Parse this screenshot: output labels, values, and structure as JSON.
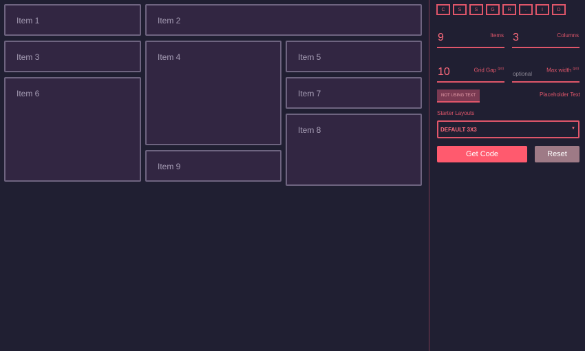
{
  "grid": {
    "items": [
      "Item 1",
      "Item 2",
      "Item 3",
      "Item 4",
      "Item 5",
      "Item 6",
      "Item 7",
      "Item 8",
      "Item 9"
    ]
  },
  "sidebar": {
    "logo_letters": [
      "C",
      "S",
      "S",
      "G",
      "R",
      ".",
      "I",
      "D"
    ],
    "items_field": {
      "value": "9",
      "label": "Items"
    },
    "columns_field": {
      "value": "3",
      "label": "Columns"
    },
    "gap_field": {
      "value": "10",
      "label": "Grid Gap",
      "unit": "(px)"
    },
    "max_width_field": {
      "placeholder": "optional",
      "label": "Max width",
      "unit": "(px)"
    },
    "text_toggle": "NOT USING TEXT",
    "placeholder_text_label": "Placeholder Text",
    "starter_label": "Starter Layouts",
    "starter_selected": "DEFAULT 3X3",
    "get_code": "Get Code",
    "reset": "Reset"
  },
  "colors": {
    "accent": "#ff5a6e",
    "background": "#201f32",
    "cell": "#322642"
  }
}
